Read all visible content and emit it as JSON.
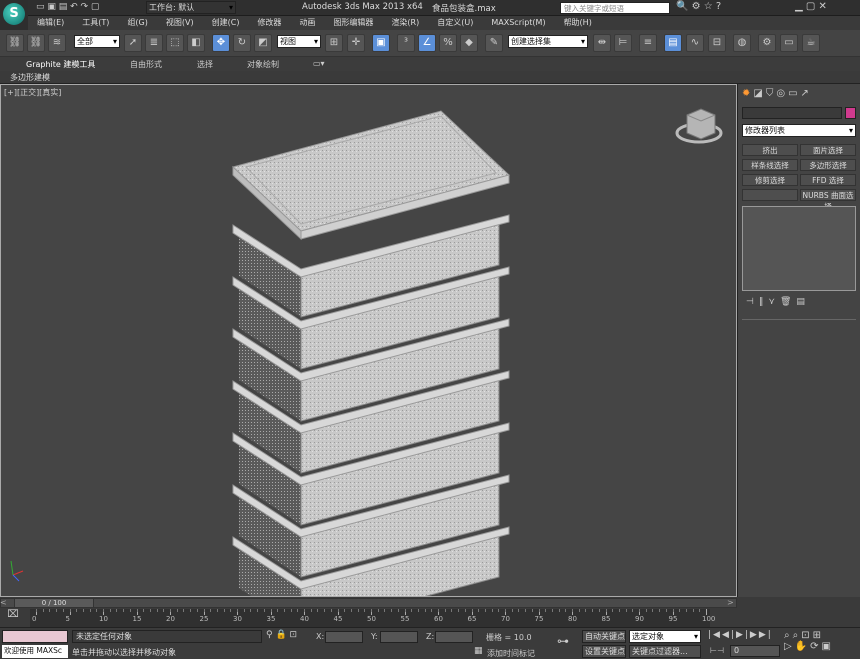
{
  "title": {
    "quick_workspace": "工作台: 默认",
    "app": "Autodesk 3ds Max  2013 x64",
    "file": "食品包装盒.max",
    "search_placeholder": "键入关键字或短语"
  },
  "menu": [
    "编辑(E)",
    "工具(T)",
    "组(G)",
    "视图(V)",
    "创建(C)",
    "修改器",
    "动画",
    "图形编辑器",
    "渲染(R)",
    "自定义(U)",
    "MAXScript(M)",
    "帮助(H)"
  ],
  "toolbar": {
    "selection_filter": "全部",
    "ref_coord": "视图",
    "named_selection": "创建选择集"
  },
  "ribbon": {
    "tabs": [
      "Graphite 建模工具",
      "自由形式",
      "选择",
      "对象绘制"
    ],
    "panel": "多边形建模"
  },
  "viewport": {
    "label": "[+][正交][真实]"
  },
  "command_panel": {
    "modifier_list": "修改器列表",
    "buttons": [
      "挤出",
      "面片选择",
      "样条线选择",
      "多边形选择",
      "修剪选择",
      "FFD 选择",
      "",
      "NURBS 曲面选择"
    ]
  },
  "timeline": {
    "frame": "0 / 100",
    "ticks": [
      "0",
      "5",
      "10",
      "15",
      "20",
      "25",
      "30",
      "35",
      "40",
      "45",
      "50",
      "55",
      "60",
      "65",
      "70",
      "75",
      "80",
      "85",
      "90",
      "95",
      "100"
    ]
  },
  "status": {
    "welcome": "欢迎使用 MAXSc",
    "selection_state": "未选定任何对象",
    "prompt": "单击并拖动以选择并移动对象",
    "x_label": "X:",
    "y_label": "Y:",
    "z_label": "Z:",
    "grid": "栅格 = 10.0",
    "add_time_tag": "添加时间标记",
    "auto_key": "自动关键点",
    "set_key": "设置关键点",
    "selected_object": "选定对象",
    "key_filters": "关键点过滤器...",
    "frame_value": "0"
  }
}
